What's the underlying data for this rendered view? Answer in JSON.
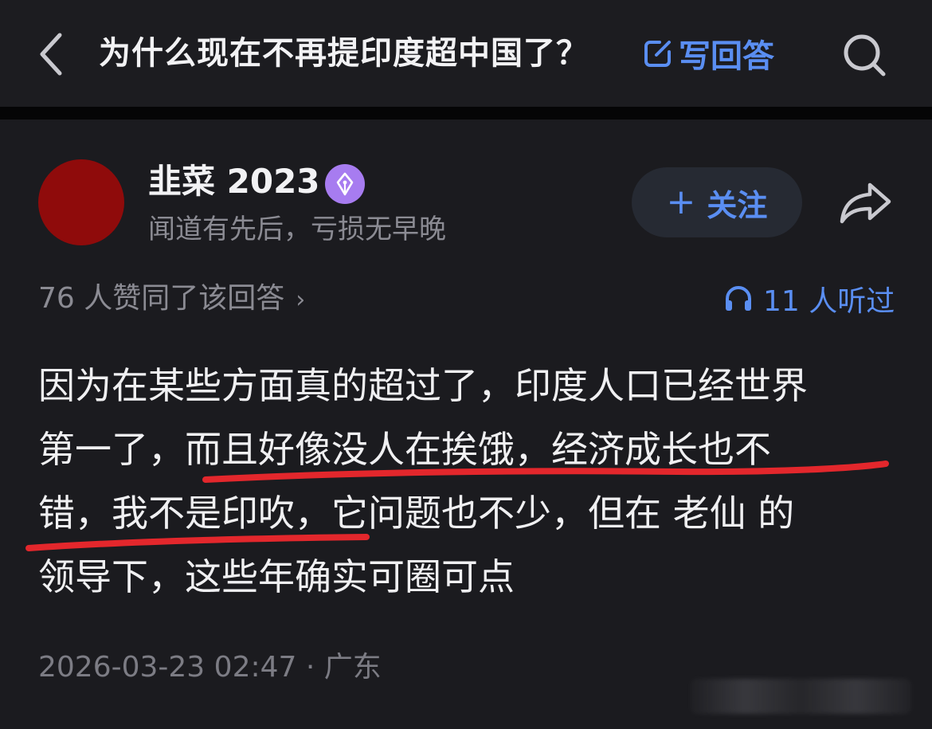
{
  "header": {
    "title": "为什么现在不再提印度超中国了？",
    "write_answer_label": "写回答",
    "back_icon": "chevron-left-icon",
    "search_icon": "search-icon"
  },
  "author": {
    "name": "韭菜 2023",
    "motto": "闻道有先后，亏损无早晚",
    "badge_icon": "pen-nib-icon",
    "follow_label": "关注",
    "follow_plus": "+"
  },
  "stats": {
    "likes_text": "76 人赞同了该回答",
    "likes_chevron": "›",
    "listens_text": "11 人听过"
  },
  "answer": {
    "lines": [
      "因为在某些方面真的超过了，印度人口已经世界",
      "第一了，而且好像没人在挨饿，经济成长也不",
      "错，我不是印吹，它问题也不少，但在 老仙 的",
      "领导下，这些年确实可圈可点"
    ]
  },
  "meta": {
    "text": "2026-03-23 02:47 · 广东"
  },
  "colors": {
    "background": "#1b1b1f",
    "accent_blue": "#5a8ef2",
    "avatar_red": "#8f0b0b",
    "badge_purple": "#a77cf0",
    "underline_red": "#e3272c",
    "muted_text": "#8b8b93"
  }
}
